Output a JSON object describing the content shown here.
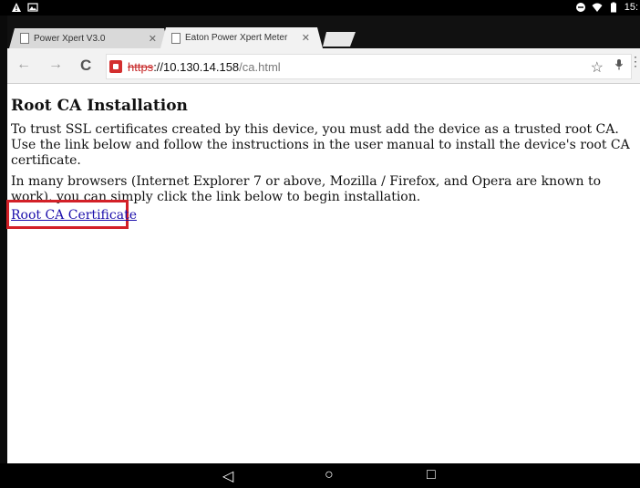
{
  "status_bar": {
    "time": "15:",
    "left_icons": [
      "warning-icon",
      "image-icon"
    ],
    "right_icons": [
      "do-not-disturb-icon",
      "wifi-icon",
      "battery-icon"
    ]
  },
  "tabs": [
    {
      "title": "Power Xpert V3.0",
      "active": false
    },
    {
      "title": "Eaton Power Xpert Meter",
      "active": true
    }
  ],
  "toolbar": {
    "back_icon": "←",
    "forward_icon": "→",
    "reload_icon": "C",
    "url_scheme": "https",
    "url_host": "://10.130.14.158",
    "url_path": "/ca.html",
    "star_icon": "☆",
    "mic_icon": "🎙",
    "menu_icon": "⋮"
  },
  "page": {
    "heading": "Root CA Installation",
    "para1": "To trust SSL certificates created by this device, you must add the device as a trusted root CA. Use the link below and follow the instructions in the user manual to install the device's root CA certificate.",
    "para2": "In many browsers (Internet Explorer 7 or above, Mozilla / Firefox, and Opera are known to work), you can simply click the link below to begin installation.",
    "link_text": "Root CA Certificate"
  },
  "navbar": {
    "back": "◁",
    "home": "○",
    "recents": "□"
  },
  "colors": {
    "highlight_box": "#d32027",
    "link": "#1a0dab",
    "insecure_scheme": "#c62828"
  }
}
